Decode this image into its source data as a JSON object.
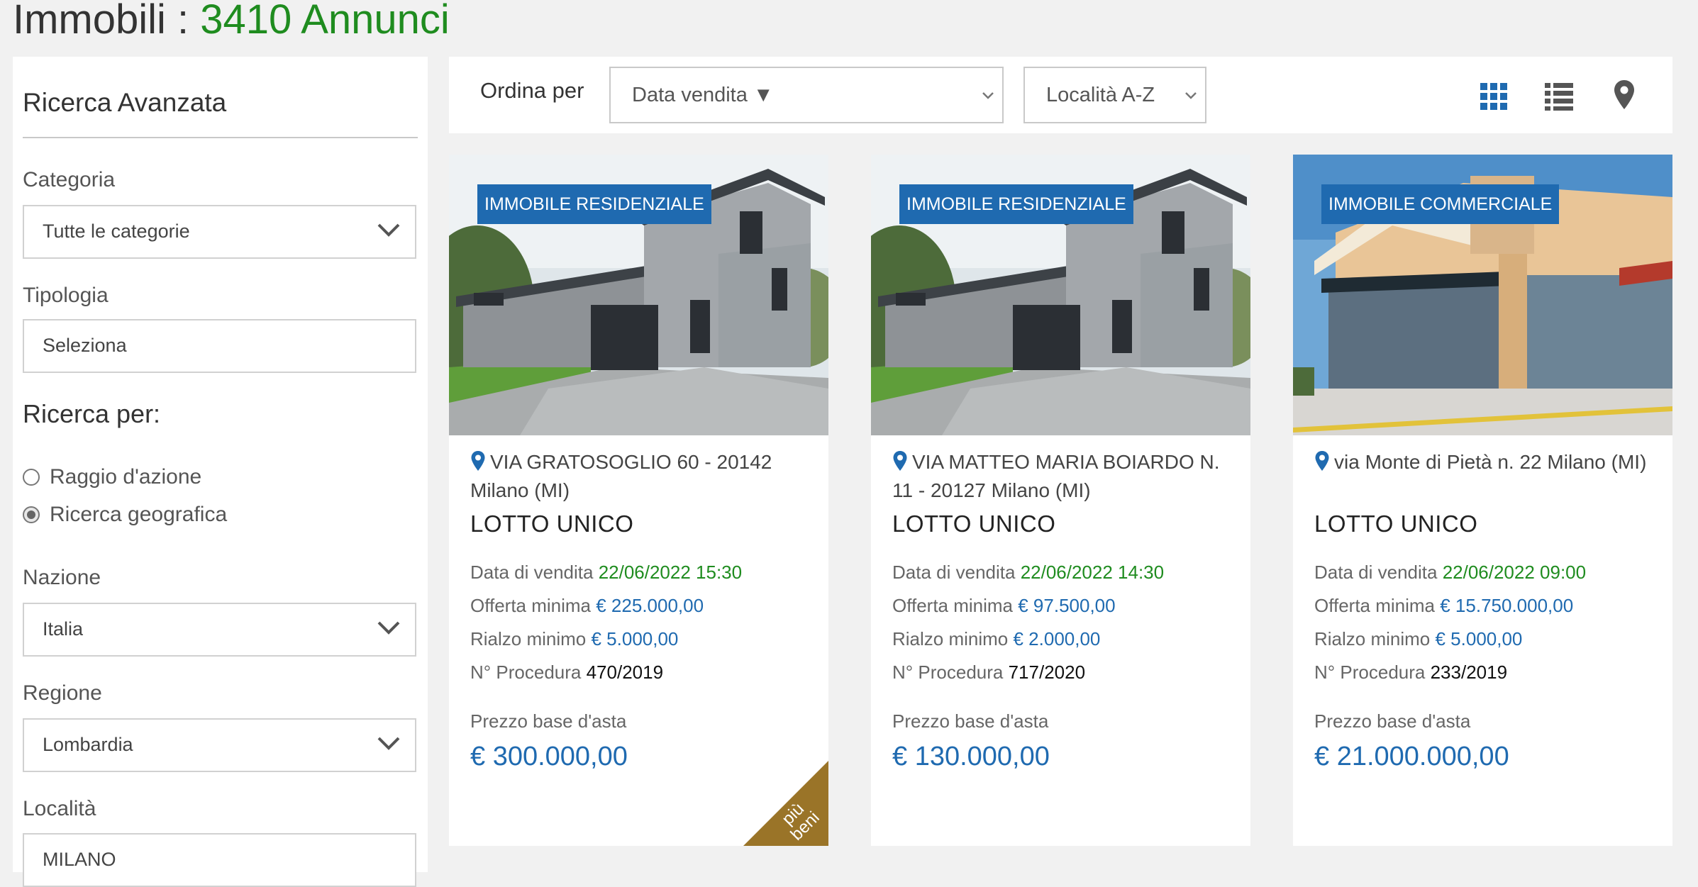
{
  "header": {
    "title": "Immobili :",
    "count": "3410 Annunci"
  },
  "sidebar": {
    "heading": "Ricerca Avanzata",
    "categoria": {
      "label": "Categoria",
      "value": "Tutte le categorie"
    },
    "tipologia": {
      "label": "Tipologia",
      "value": "Seleziona"
    },
    "ricerca_per": {
      "label": "Ricerca per:",
      "options": [
        {
          "label": "Raggio d'azione",
          "checked": false
        },
        {
          "label": "Ricerca geografica",
          "checked": true
        }
      ]
    },
    "nazione": {
      "label": "Nazione",
      "value": "Italia"
    },
    "regione": {
      "label": "Regione",
      "value": "Lombardia"
    },
    "localita": {
      "label": "Località",
      "value": "MILANO"
    }
  },
  "toolbar": {
    "sort_label": "Ordina per",
    "sort_primary": "Data vendita ▼",
    "sort_secondary": "Località A-Z",
    "views": [
      "grid-view-icon",
      "list-view-icon",
      "map-view-icon"
    ],
    "active_view_color": "#1f6ab0"
  },
  "labels": {
    "data_vendita": "Data di vendita",
    "offerta_minima": "Offerta minima",
    "rialzo_minimo": "Rialzo minimo",
    "procedura": "N° Procedura",
    "prezzo_base": "Prezzo base d'asta"
  },
  "cards": [
    {
      "badge": "IMMOBILE RESIDENZIALE",
      "address": "VIA GRATOSOGLIO 60 - 20142 Milano (MI)",
      "lotto": "LOTTO UNICO",
      "data_vendita": "22/06/2022 15:30",
      "offerta_minima": "€ 225.000,00",
      "rialzo_minimo": "€ 5.000,00",
      "procedura": "470/2019",
      "prezzo_base": "€ 300.000,00",
      "ribbon": "più beni"
    },
    {
      "badge": "IMMOBILE RESIDENZIALE",
      "address": "VIA MATTEO MARIA BOIARDO N. 11 - 20127 Milano (MI)",
      "lotto": "LOTTO UNICO",
      "data_vendita": "22/06/2022 14:30",
      "offerta_minima": "€ 97.500,00",
      "rialzo_minimo": "€ 2.000,00",
      "procedura": "717/2020",
      "prezzo_base": "€ 130.000,00"
    },
    {
      "badge": "IMMOBILE COMMERCIALE",
      "address": "via Monte di Pietà n. 22 Milano (MI)",
      "lotto": "LOTTO UNICO",
      "data_vendita": "22/06/2022 09:00",
      "offerta_minima": "€ 15.750.000,00",
      "rialzo_minimo": "€ 5.000,00",
      "procedura": "233/2019",
      "prezzo_base": "€ 21.000.000,00"
    }
  ]
}
